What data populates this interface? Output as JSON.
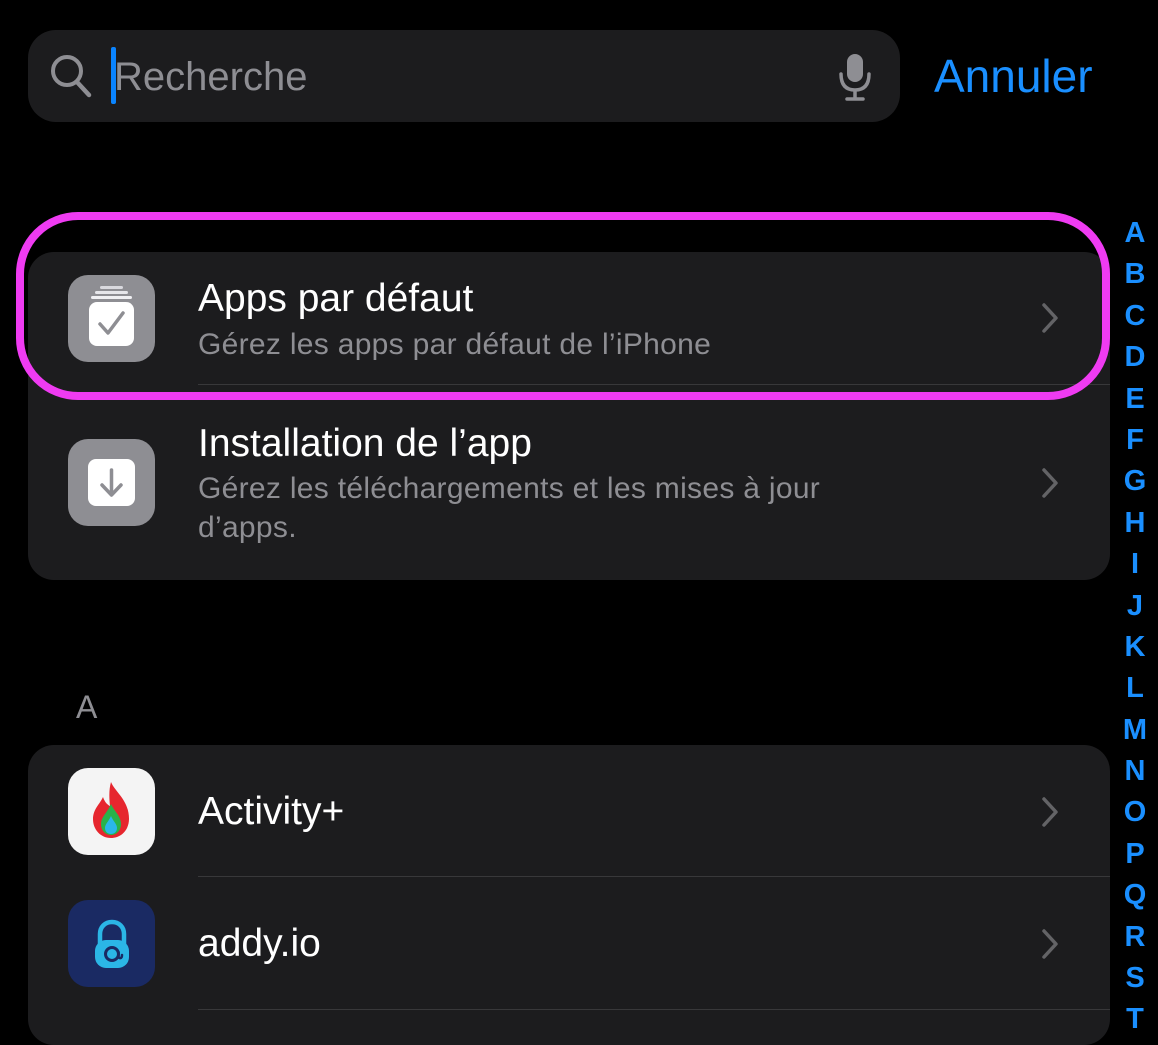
{
  "search": {
    "placeholder": "Recherche",
    "value": "",
    "icon": "search-icon",
    "mic_icon": "microphone-icon",
    "cancel_label": "Annuler"
  },
  "colors": {
    "background": "#000000",
    "card": "#1c1c1e",
    "accent": "#1a8fff",
    "secondary_text": "#8e8e93",
    "highlight": "#ef3bf2"
  },
  "top_group": {
    "rows": [
      {
        "title": "Apps par défaut",
        "subtitle": "Gérez les apps par défaut de l’iPhone",
        "icon": "default-apps-icon",
        "highlighted": true
      },
      {
        "title": "Installation de l’app",
        "subtitle": "Gérez les téléchargements et les mises à jour d’apps.",
        "icon": "app-installation-icon"
      }
    ]
  },
  "section_a": {
    "header": "A",
    "rows": [
      {
        "title": "Activity+",
        "icon": "activity-plus-flame-icon"
      },
      {
        "title": "addy.io",
        "icon": "addy-io-icon"
      }
    ]
  },
  "alpha_index": [
    "A",
    "B",
    "C",
    "D",
    "E",
    "F",
    "G",
    "H",
    "I",
    "J",
    "K",
    "L",
    "M",
    "N",
    "O",
    "P",
    "Q",
    "R",
    "S",
    "T"
  ]
}
